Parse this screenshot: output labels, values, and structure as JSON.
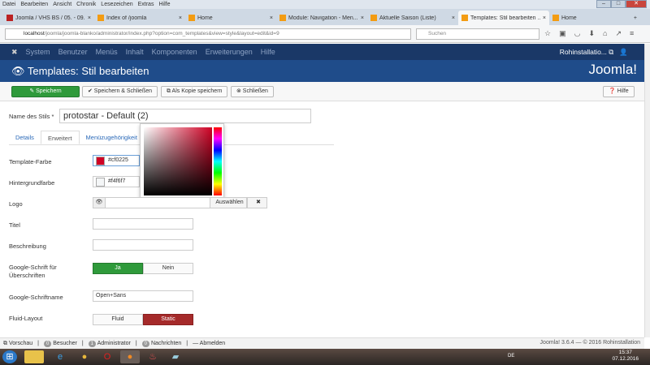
{
  "menubar": [
    "Datei",
    "Bearbeiten",
    "Ansicht",
    "Chronik",
    "Lesezeichen",
    "Extras",
    "Hilfe"
  ],
  "tabs": [
    {
      "label": "Joomla / VHS BS / 05. - 09...."
    },
    {
      "label": "Index of /joomla"
    },
    {
      "label": "Home"
    },
    {
      "label": "Module: Navigation - Men..."
    },
    {
      "label": "Aktuelle Saison (Liste)"
    },
    {
      "label": "Templates: Stil bearbeiten ..."
    },
    {
      "label": "Home"
    }
  ],
  "url": {
    "host": "localhost",
    "path": "/joomla/joomla-blanko/administrator/index.php?option=com_templates&view=style&layout=edit&id=9"
  },
  "search_placeholder": "Suchen",
  "jnav": {
    "items": [
      "System",
      "Benutzer",
      "Menüs",
      "Inhalt",
      "Komponenten",
      "Erweiterungen",
      "Hilfe"
    ],
    "site": "Rohinstallatio... ⧉",
    "user": "👤"
  },
  "header": {
    "title": "Templates: Stil bearbeiten",
    "logo": "Joomla!"
  },
  "toolbar": {
    "save": "✎ Speichern",
    "save_close": "✔ Speichern & Schließen",
    "save_copy": "⧉ Als Kopie speichern",
    "close": "⊗ Schließen",
    "help": "❓ Hilfe"
  },
  "form": {
    "name_label": "Name des Stils *",
    "name_value": "protostar - Default (2)",
    "tabs": [
      "Details",
      "Erweitert",
      "Menüzugehörigkeit"
    ],
    "template_color_label": "Template-Farbe",
    "template_color": "#cf0225",
    "bg_color_label": "Hintergrundfarbe",
    "bg_color": "#f4f6f7",
    "logo_label": "Logo",
    "logo_select": "Auswählen",
    "logo_clear": "✖",
    "title_label": "Titel",
    "desc_label": "Beschreibung",
    "gfont_label": "Google-Schrift für Überschriften",
    "yes": "Ja",
    "no": "Nein",
    "gfont_name_label": "Google-Schriftname",
    "gfont_name": "Open+Sans",
    "fluid_label": "Fluid-Layout",
    "fluid": "Fluid",
    "static": "Static"
  },
  "colors": {
    "accent": "#cf0225",
    "green": "#2f9a3b",
    "navy": "#1a3867"
  },
  "status": {
    "preview": "⧉ Vorschau",
    "visitors_count": "0",
    "visitors": "Besucher",
    "admin_count": "1",
    "admin": "Administrator",
    "msg_count": "0",
    "messages": "Nachrichten",
    "logout": "— Abmelden",
    "copyright": "Joomla! 3.6.4 — © 2016 Rohinstallation"
  },
  "clock": {
    "time": "15:37",
    "date": "07.12.2016",
    "lang": "DE"
  }
}
